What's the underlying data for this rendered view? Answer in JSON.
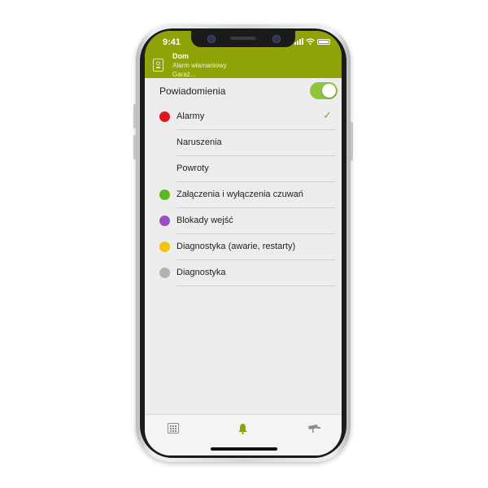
{
  "colors": {
    "header_bg": "#8fa308",
    "toggle_on": "#8ec53a",
    "accent": "#8fa308"
  },
  "status_bar": {
    "time": "9:41",
    "icons": [
      "signal-icon",
      "wifi-icon",
      "battery-icon"
    ]
  },
  "header": {
    "title": "Dom",
    "subtitle_1": "Alarm włamaniowy",
    "subtitle_2": "Garaż...",
    "icon": "home-device-icon"
  },
  "notifications": {
    "label": "Powiadomienia",
    "enabled": true
  },
  "items": [
    {
      "label": "Alarmy",
      "dot_color": "#e0161e",
      "checked": true
    },
    {
      "label": "Naruszenia",
      "dot_color": "",
      "checked": false
    },
    {
      "label": "Powroty",
      "dot_color": "",
      "checked": false
    },
    {
      "label": "Załączenia i wyłączenia czuwań",
      "dot_color": "#5db81f",
      "checked": false
    },
    {
      "label": "Blokady wejść",
      "dot_color": "#9b4fc4",
      "checked": false
    },
    {
      "label": "Diagnostyka (awarie, restarty)",
      "dot_color": "#f5c400",
      "checked": false
    },
    {
      "label": "Diagnostyka",
      "dot_color": "#b2b2b2",
      "checked": false
    }
  ],
  "check_glyph": "✓",
  "tabbar": {
    "tabs": [
      {
        "name": "keypad-tab",
        "icon": "keypad-icon",
        "active": false
      },
      {
        "name": "notifications-tab",
        "icon": "bell-icon",
        "active": true
      },
      {
        "name": "camera-tab",
        "icon": "camera-icon",
        "active": false
      }
    ]
  }
}
